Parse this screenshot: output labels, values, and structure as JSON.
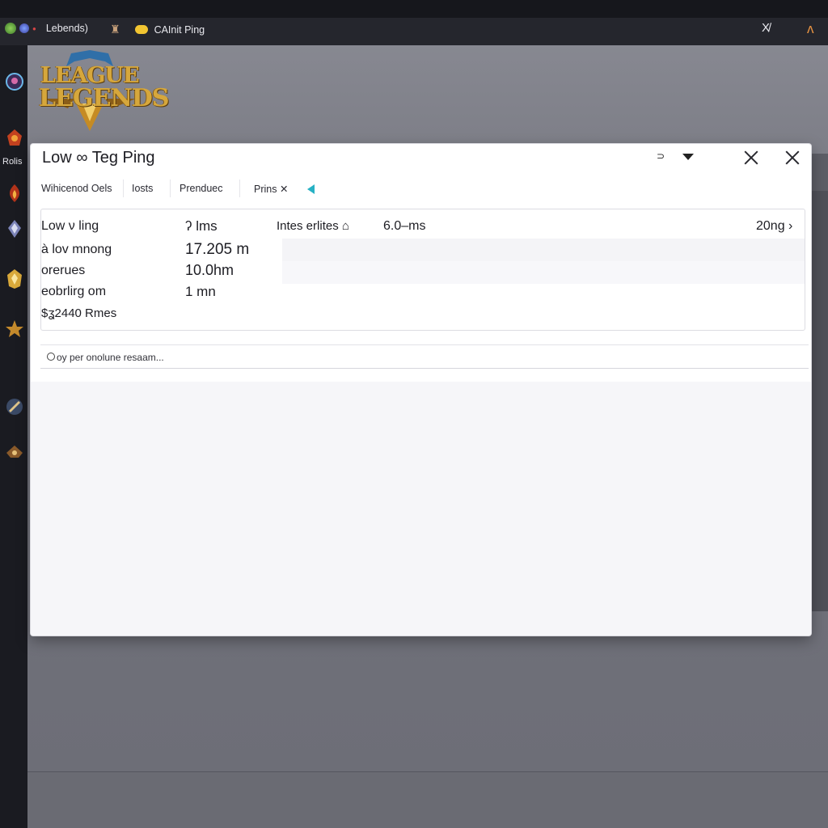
{
  "topbar": {
    "app_label": "Lebends)",
    "tab_label": "CAInit Ping",
    "right_icon_1": "X̸",
    "right_icon_2": "ʌ"
  },
  "sidebar": {
    "label": "Rolis",
    "icons": [
      "champion-portrait-icon",
      "fire-emblem-icon",
      "flame-icon",
      "crystal-icon",
      "gold-crest-icon",
      "gold-star-icon",
      "blade-icon",
      "helm-icon"
    ]
  },
  "brand": {
    "line1": "LEAGUE",
    "line2": "LEGENDS"
  },
  "dialog": {
    "title": "Low ∞ Teg Ping",
    "minimize_glyph": "⊃",
    "tabs": [
      "Wihicenod Oels",
      "Iosts",
      "Prenduec",
      "Prins ✕"
    ],
    "stats": {
      "rows": [
        {
          "label": "Low ν ling",
          "value": "ʔ lms"
        },
        {
          "label": "à lov mnong",
          "value": "17.205 m"
        },
        {
          "label": "orerues",
          "value": "10.0hm"
        },
        {
          "label": "eobrlirg om",
          "value": "1 mn"
        },
        {
          "label": "$ʓ2440 Rmes",
          "value": ""
        }
      ],
      "extra_label": "Intes erlites ⌂",
      "extra_value": "6.0–ms",
      "right_value": "20ng ›"
    },
    "search": {
      "text": "oy per onolune resaam..."
    }
  },
  "colors": {
    "accent_teal": "#27b1c4",
    "gold": "#d6a73c",
    "pill_yellow": "#f2c531"
  }
}
